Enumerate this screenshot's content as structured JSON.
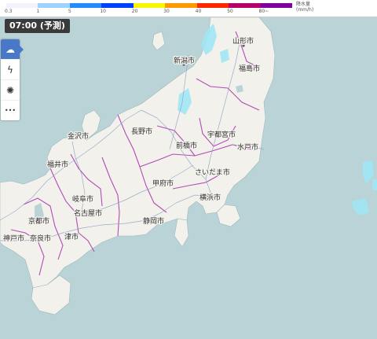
{
  "legend": {
    "ticks": [
      "0.3",
      "1",
      "5",
      "10",
      "20",
      "30",
      "40",
      "50",
      "80~"
    ],
    "colors": [
      "#f2f2ff",
      "#a0d2ff",
      "#218cff",
      "#0041ff",
      "#faf500",
      "#ff9900",
      "#ff2800",
      "#b40068",
      "#8000a0"
    ],
    "unit_line1": "降水量",
    "unit_line2": "(mm/h)"
  },
  "time_label": "07:00 (予測)",
  "toolbar": {
    "items": [
      {
        "icon": "rain-cloud-icon",
        "glyph": "☁",
        "active": true
      },
      {
        "icon": "lightning-icon",
        "glyph": "ϟ",
        "active": false
      },
      {
        "icon": "typhoon-icon",
        "glyph": "✺",
        "active": false
      },
      {
        "icon": "more-icon",
        "glyph": "•••",
        "active": false
      }
    ]
  },
  "cities": {
    "yamagata": "山形市",
    "niigata": "新潟市",
    "fukushima": "福島市",
    "kanazawa": "金沢市",
    "nagano": "長野市",
    "utsunomiya": "宇都宮市",
    "maebashi": "前橋市",
    "mito": "水戸市",
    "fukui": "福井市",
    "saitama": "さいたま市",
    "kofu": "甲府市",
    "gifu": "岐阜市",
    "yokohama": "横浜市",
    "kyoto": "京都市",
    "nagoya": "名古屋市",
    "shizuoka": "静岡市",
    "kobe": "神戸市",
    "nara": "奈良市",
    "tsu": "津市"
  }
}
